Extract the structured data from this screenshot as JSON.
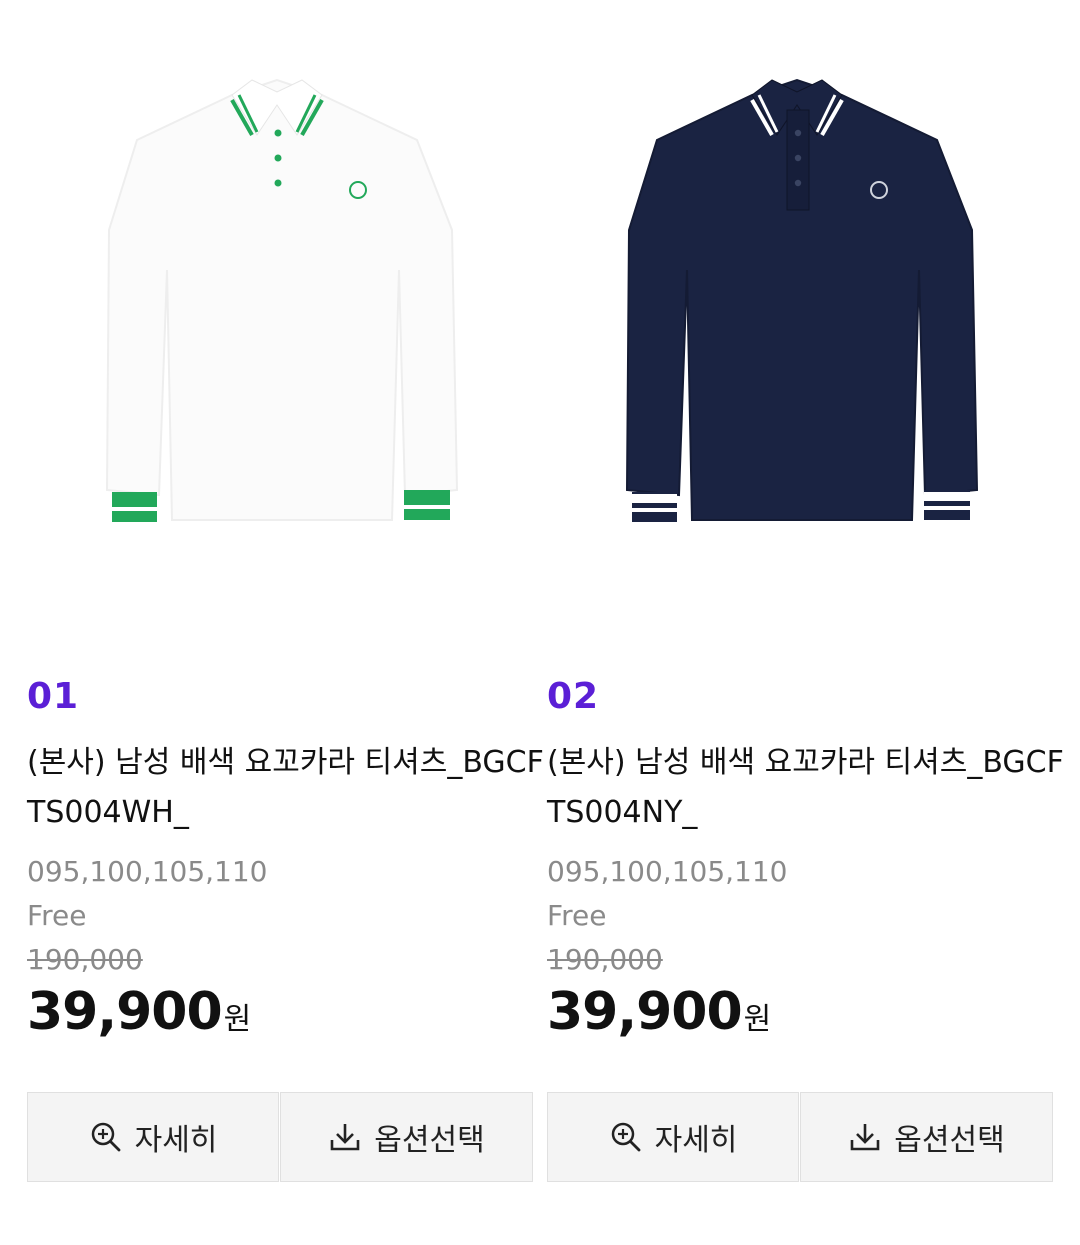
{
  "products": [
    {
      "index": "01",
      "title": "(본사) 남성 배색 요꼬카라 티셔츠_BGCFTS004WH_",
      "sizes": "095,100,105,110",
      "color_option": "Free",
      "original_price": "190,000",
      "sale_price": "39,900",
      "currency": "원",
      "detail_label": "자세히",
      "option_label": "옵션선택",
      "shirt_color": "#ffffff",
      "accent_color": "#22a85a"
    },
    {
      "index": "02",
      "title": "(본사) 남성 배색 요꼬카라 티셔츠_BGCFTS004NY_",
      "sizes": "095,100,105,110",
      "color_option": "Free",
      "original_price": "190,000",
      "sale_price": "39,900",
      "currency": "원",
      "detail_label": "자세히",
      "option_label": "옵션선택",
      "shirt_color": "#1a2342",
      "accent_color": "#ffffff"
    }
  ],
  "colors": {
    "index_color": "#5b1fd6",
    "muted_text": "#8a8a8a",
    "button_bg": "#f4f4f4"
  },
  "icons": {
    "detail_icon": "zoom-in-icon",
    "option_icon": "download-icon"
  }
}
